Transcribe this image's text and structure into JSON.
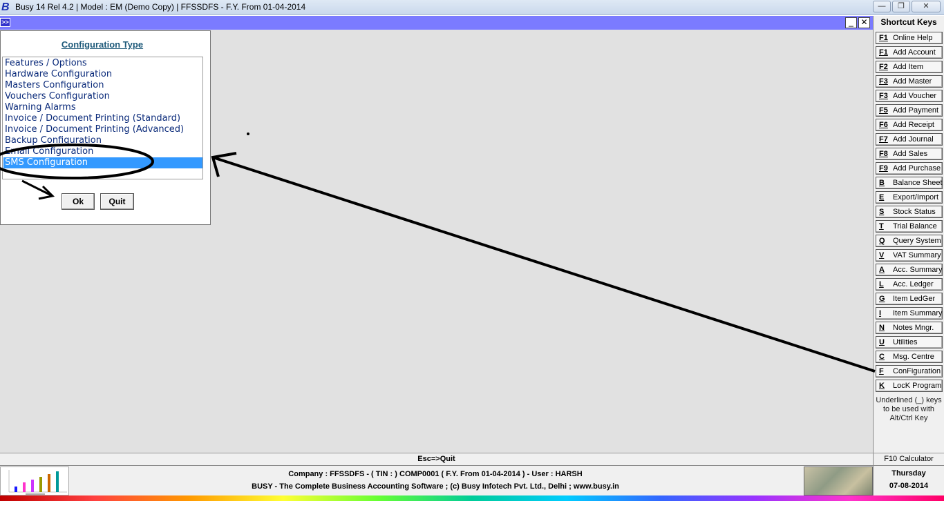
{
  "titlebar": {
    "logo": "B",
    "title": "Busy 14  Rel 4.2  |  Model : EM (Demo Copy)  |  FFSSDFS - F.Y. From 01-04-2014",
    "minimize": "—",
    "restore": "❐",
    "close": "✕"
  },
  "childbar": {
    "expand": ">>",
    "minimize": "_",
    "close": "✕"
  },
  "dialog": {
    "title": "Configuration Type",
    "items": [
      "Features / Options",
      "Hardware Configuration",
      "Masters Configuration",
      "Vouchers Configuration",
      "Warning Alarms",
      "Invoice / Document Printing (Standard)",
      "Invoice / Document Printing (Advanced)",
      "Backup Configuration",
      "Email Configuration",
      "SMS Configuration"
    ],
    "selected_index": 9,
    "ok": "Ok",
    "quit": "Quit"
  },
  "shortcuts": {
    "header": "Shortcut Keys",
    "items": [
      {
        "key": "F1",
        "label": "Online Help"
      },
      {
        "key": "F1",
        "label": "Add Account"
      },
      {
        "key": "F2",
        "label": "Add Item"
      },
      {
        "key": "F3",
        "label": "Add Master"
      },
      {
        "key": "F3",
        "label": "Add Voucher"
      },
      {
        "key": "F5",
        "label": "Add Payment"
      },
      {
        "key": "F6",
        "label": "Add Receipt"
      },
      {
        "key": "F7",
        "label": "Add Journal"
      },
      {
        "key": "F8",
        "label": "Add Sales"
      },
      {
        "key": "F9",
        "label": "Add Purchase"
      },
      {
        "key": "B",
        "label": "Balance Sheet"
      },
      {
        "key": "E",
        "label": "Export/Import"
      },
      {
        "key": "S",
        "label": "Stock Status"
      },
      {
        "key": "T",
        "label": "Trial Balance"
      },
      {
        "key": "Q",
        "label": "Query System"
      },
      {
        "key": "V",
        "label": "VAT Summary"
      },
      {
        "key": "A",
        "label": "Acc. Summary"
      },
      {
        "key": "L",
        "label": "Acc. Ledger"
      },
      {
        "key": "G",
        "label": "Item LedGer"
      },
      {
        "key": "I",
        "label": "Item Summary"
      },
      {
        "key": "N",
        "label": "Notes Mngr."
      },
      {
        "key": "U",
        "label": "Utilities"
      },
      {
        "key": "C",
        "label": "Msg. Centre"
      },
      {
        "key": "F",
        "label": "ConFiguration"
      },
      {
        "key": "K",
        "label": "LocK Program"
      }
    ],
    "note": "Underlined (_) keys to be used with Alt/Ctrl Key"
  },
  "status": {
    "esc": "Esc=>Quit",
    "f10": "F10 Calculator"
  },
  "footer": {
    "company": "Company : FFSSDFS - ( TIN :  ) COMP0001 ( F.Y. From 01-04-2014 ) - User : HARSH",
    "tagline": "BUSY - The Complete Business Accounting Software  ;  (c) Busy Infotech Pvt. Ltd., Delhi  ;  www.busy.in",
    "day": "Thursday",
    "date": "07-08-2014"
  },
  "colors": {
    "childbar": "#7b7bff",
    "selection": "#3399ff",
    "list_text": "#0a2a7a"
  }
}
